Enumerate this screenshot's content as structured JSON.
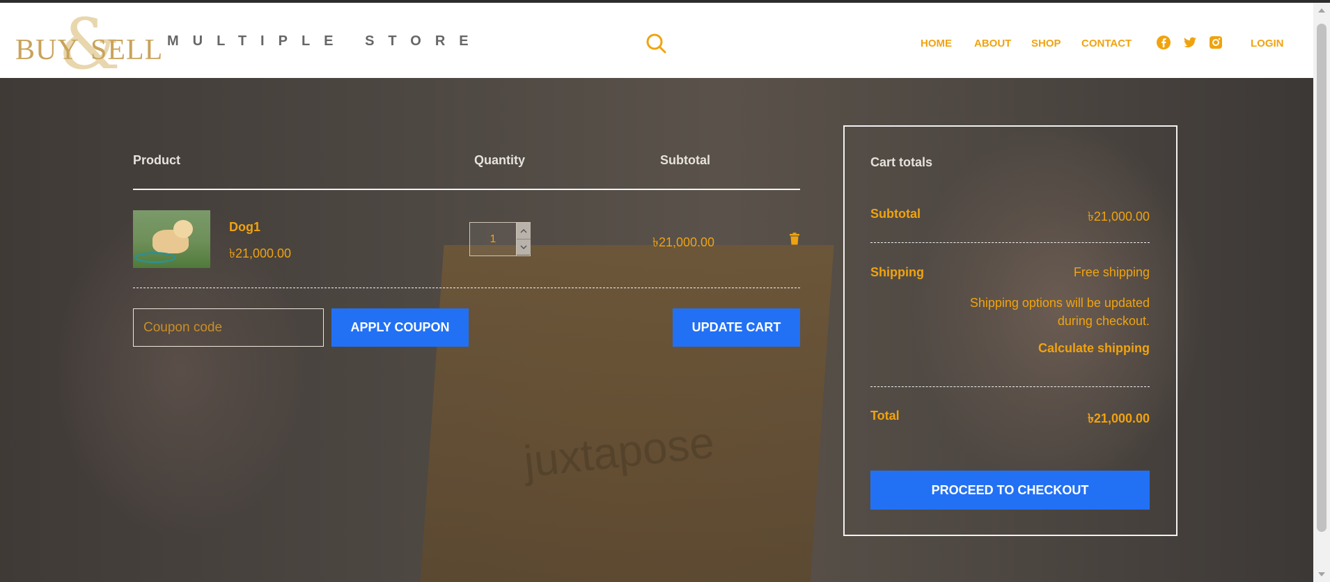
{
  "brand": {
    "logo_word_left": "BUY",
    "logo_ampersand": "&",
    "logo_word_right": "SELL",
    "tagline": "MULTIPLE STORE"
  },
  "nav": {
    "items": [
      "HOME",
      "ABOUT",
      "SHOP",
      "CONTACT"
    ],
    "login": "LOGIN",
    "social_icons": [
      "facebook-icon",
      "twitter-icon",
      "instagram-icon"
    ]
  },
  "cart": {
    "headers": {
      "product": "Product",
      "quantity": "Quantity",
      "subtotal": "Subtotal"
    },
    "items": [
      {
        "name": "Dog1",
        "price": "৳21,000.00",
        "quantity": "1",
        "subtotal": "৳21,000.00"
      }
    ],
    "coupon_placeholder": "Coupon code",
    "apply_coupon": "APPLY COUPON",
    "update_cart": "UPDATE CART"
  },
  "totals": {
    "title": "Cart totals",
    "subtotal_label": "Subtotal",
    "subtotal_value": "৳21,000.00",
    "shipping_label": "Shipping",
    "shipping_value": "Free shipping",
    "shipping_note_line1": "Shipping options will be updated",
    "shipping_note_line2": "during checkout.",
    "calculate_shipping": "Calculate shipping",
    "total_label": "Total",
    "total_value": "৳21,000.00",
    "checkout": "PROCEED TO CHECKOUT"
  },
  "colors": {
    "accent": "#f0a30f",
    "button": "#2271f5",
    "logo_gold": "#c9a35a"
  }
}
